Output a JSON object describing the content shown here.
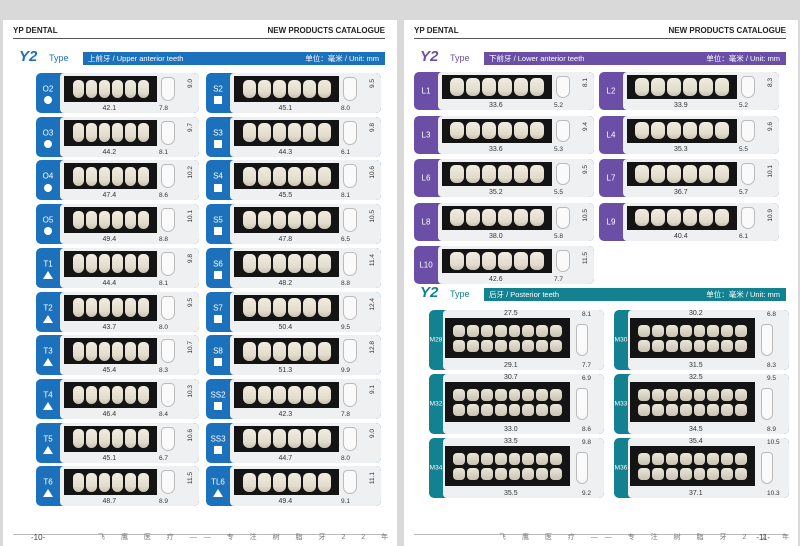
{
  "header": {
    "brand": "YP DENTAL",
    "catalogue": "NEW PRODUCTS CATALOGUE"
  },
  "sections": {
    "upper": {
      "type_label": "Y2",
      "type_word": "Type",
      "title": "上前牙 / Upper anterior teeth",
      "unit": "单位：毫米 / Unit: mm",
      "color": "#1c71bd"
    },
    "lower": {
      "type_label": "Y2",
      "type_word": "Type",
      "title": "下前牙 / Lower anterior teeth",
      "unit": "单位：毫米 / Unit: mm",
      "color": "#6b4fa6"
    },
    "posterior": {
      "type_label": "Y2",
      "type_word": "Type",
      "title": "后牙 / Posterior teeth",
      "unit": "单位：毫米 / Unit: mm",
      "color": "#13818f"
    }
  },
  "upper_left": [
    {
      "code": "O2",
      "shape": "circle",
      "width": "42.1",
      "height": "9.0",
      "depth": "7.8"
    },
    {
      "code": "O3",
      "shape": "circle",
      "width": "44.2",
      "height": "9.7",
      "depth": "8.1"
    },
    {
      "code": "O4",
      "shape": "circle",
      "width": "47.4",
      "height": "10.2",
      "depth": "8.6"
    },
    {
      "code": "O5",
      "shape": "circle",
      "width": "49.4",
      "height": "10.1",
      "depth": "8.8"
    },
    {
      "code": "T1",
      "shape": "tri",
      "width": "44.4",
      "height": "9.8",
      "depth": "8.1"
    },
    {
      "code": "T2",
      "shape": "tri",
      "width": "43.7",
      "height": "9.5",
      "depth": "8.0"
    },
    {
      "code": "T3",
      "shape": "tri",
      "width": "45.4",
      "height": "10.7",
      "depth": "8.3"
    },
    {
      "code": "T4",
      "shape": "tri",
      "width": "46.4",
      "height": "10.3",
      "depth": "8.4"
    },
    {
      "code": "T5",
      "shape": "tri",
      "width": "45.1",
      "height": "10.6",
      "depth": "6.7"
    },
    {
      "code": "T6",
      "shape": "tri",
      "width": "48.7",
      "height": "11.5",
      "depth": "8.9"
    }
  ],
  "upper_right": [
    {
      "code": "S2",
      "shape": "square",
      "width": "45.1",
      "height": "9.5",
      "depth": "8.0"
    },
    {
      "code": "S3",
      "shape": "square",
      "width": "44.3",
      "height": "9.8",
      "depth": "6.1"
    },
    {
      "code": "S4",
      "shape": "square",
      "width": "45.5",
      "height": "10.6",
      "depth": "8.1"
    },
    {
      "code": "S5",
      "shape": "square",
      "width": "47.8",
      "height": "10.5",
      "depth": "6.5"
    },
    {
      "code": "S6",
      "shape": "square",
      "width": "48.2",
      "height": "11.4",
      "depth": "8.8"
    },
    {
      "code": "S7",
      "shape": "square",
      "width": "50.4",
      "height": "12.4",
      "depth": "9.5"
    },
    {
      "code": "S8",
      "shape": "square",
      "width": "51.3",
      "height": "12.8",
      "depth": "9.9"
    },
    {
      "code": "SS2",
      "shape": "square",
      "width": "42.3",
      "height": "9.1",
      "depth": "7.8"
    },
    {
      "code": "SS3",
      "shape": "square",
      "width": "44.7",
      "height": "9.0",
      "depth": "8.0"
    },
    {
      "code": "TL6",
      "shape": "tri",
      "width": "49.4",
      "height": "11.1",
      "depth": "9.1"
    }
  ],
  "lower": [
    {
      "code": "L1",
      "width": "33.6",
      "height": "8.1",
      "depth": "5.2"
    },
    {
      "code": "L2",
      "width": "33.9",
      "height": "8.3",
      "depth": "5.2"
    },
    {
      "code": "L3",
      "width": "33.6",
      "height": "9.4",
      "depth": "5.3"
    },
    {
      "code": "L4",
      "width": "35.3",
      "height": "9.6",
      "depth": "5.5"
    },
    {
      "code": "L6",
      "width": "35.2",
      "height": "9.5",
      "depth": "5.5"
    },
    {
      "code": "L7",
      "width": "36.7",
      "height": "10.1",
      "depth": "5.7"
    },
    {
      "code": "L8",
      "width": "38.0",
      "height": "10.5",
      "depth": "5.8"
    },
    {
      "code": "L9",
      "width": "40.4",
      "height": "10.9",
      "depth": "6.1"
    },
    {
      "code": "L10",
      "width": "42.6",
      "height": "11.5",
      "depth": "7.7"
    }
  ],
  "posterior": [
    {
      "code": "M28",
      "top": "27.5",
      "bottom": "29.1",
      "h1": "8.1",
      "h2": "7.7"
    },
    {
      "code": "M30",
      "top": "30.2",
      "bottom": "31.5",
      "h1": "6.8",
      "h2": "8.3"
    },
    {
      "code": "M32",
      "top": "30.7",
      "bottom": "33.0",
      "h1": "6.9",
      "h2": "8.6"
    },
    {
      "code": "M33",
      "top": "32.5",
      "bottom": "34.5",
      "h1": "9.5",
      "h2": "8.9"
    },
    {
      "code": "M34",
      "top": "33.5",
      "bottom": "35.5",
      "h1": "9.8",
      "h2": "9.2"
    },
    {
      "code": "M36",
      "top": "35.4",
      "bottom": "37.1",
      "h1": "10.5",
      "h2": "10.3"
    }
  ],
  "footer": {
    "left_text": "飞 鹰 医 疗 —— 专 注 树 脂 牙 2 2 年",
    "right_text": "飞 鹰 医 疗 —— 专 注 树 脂 牙 2 2 年",
    "page_left": "-10-",
    "page_right": "-11-"
  }
}
